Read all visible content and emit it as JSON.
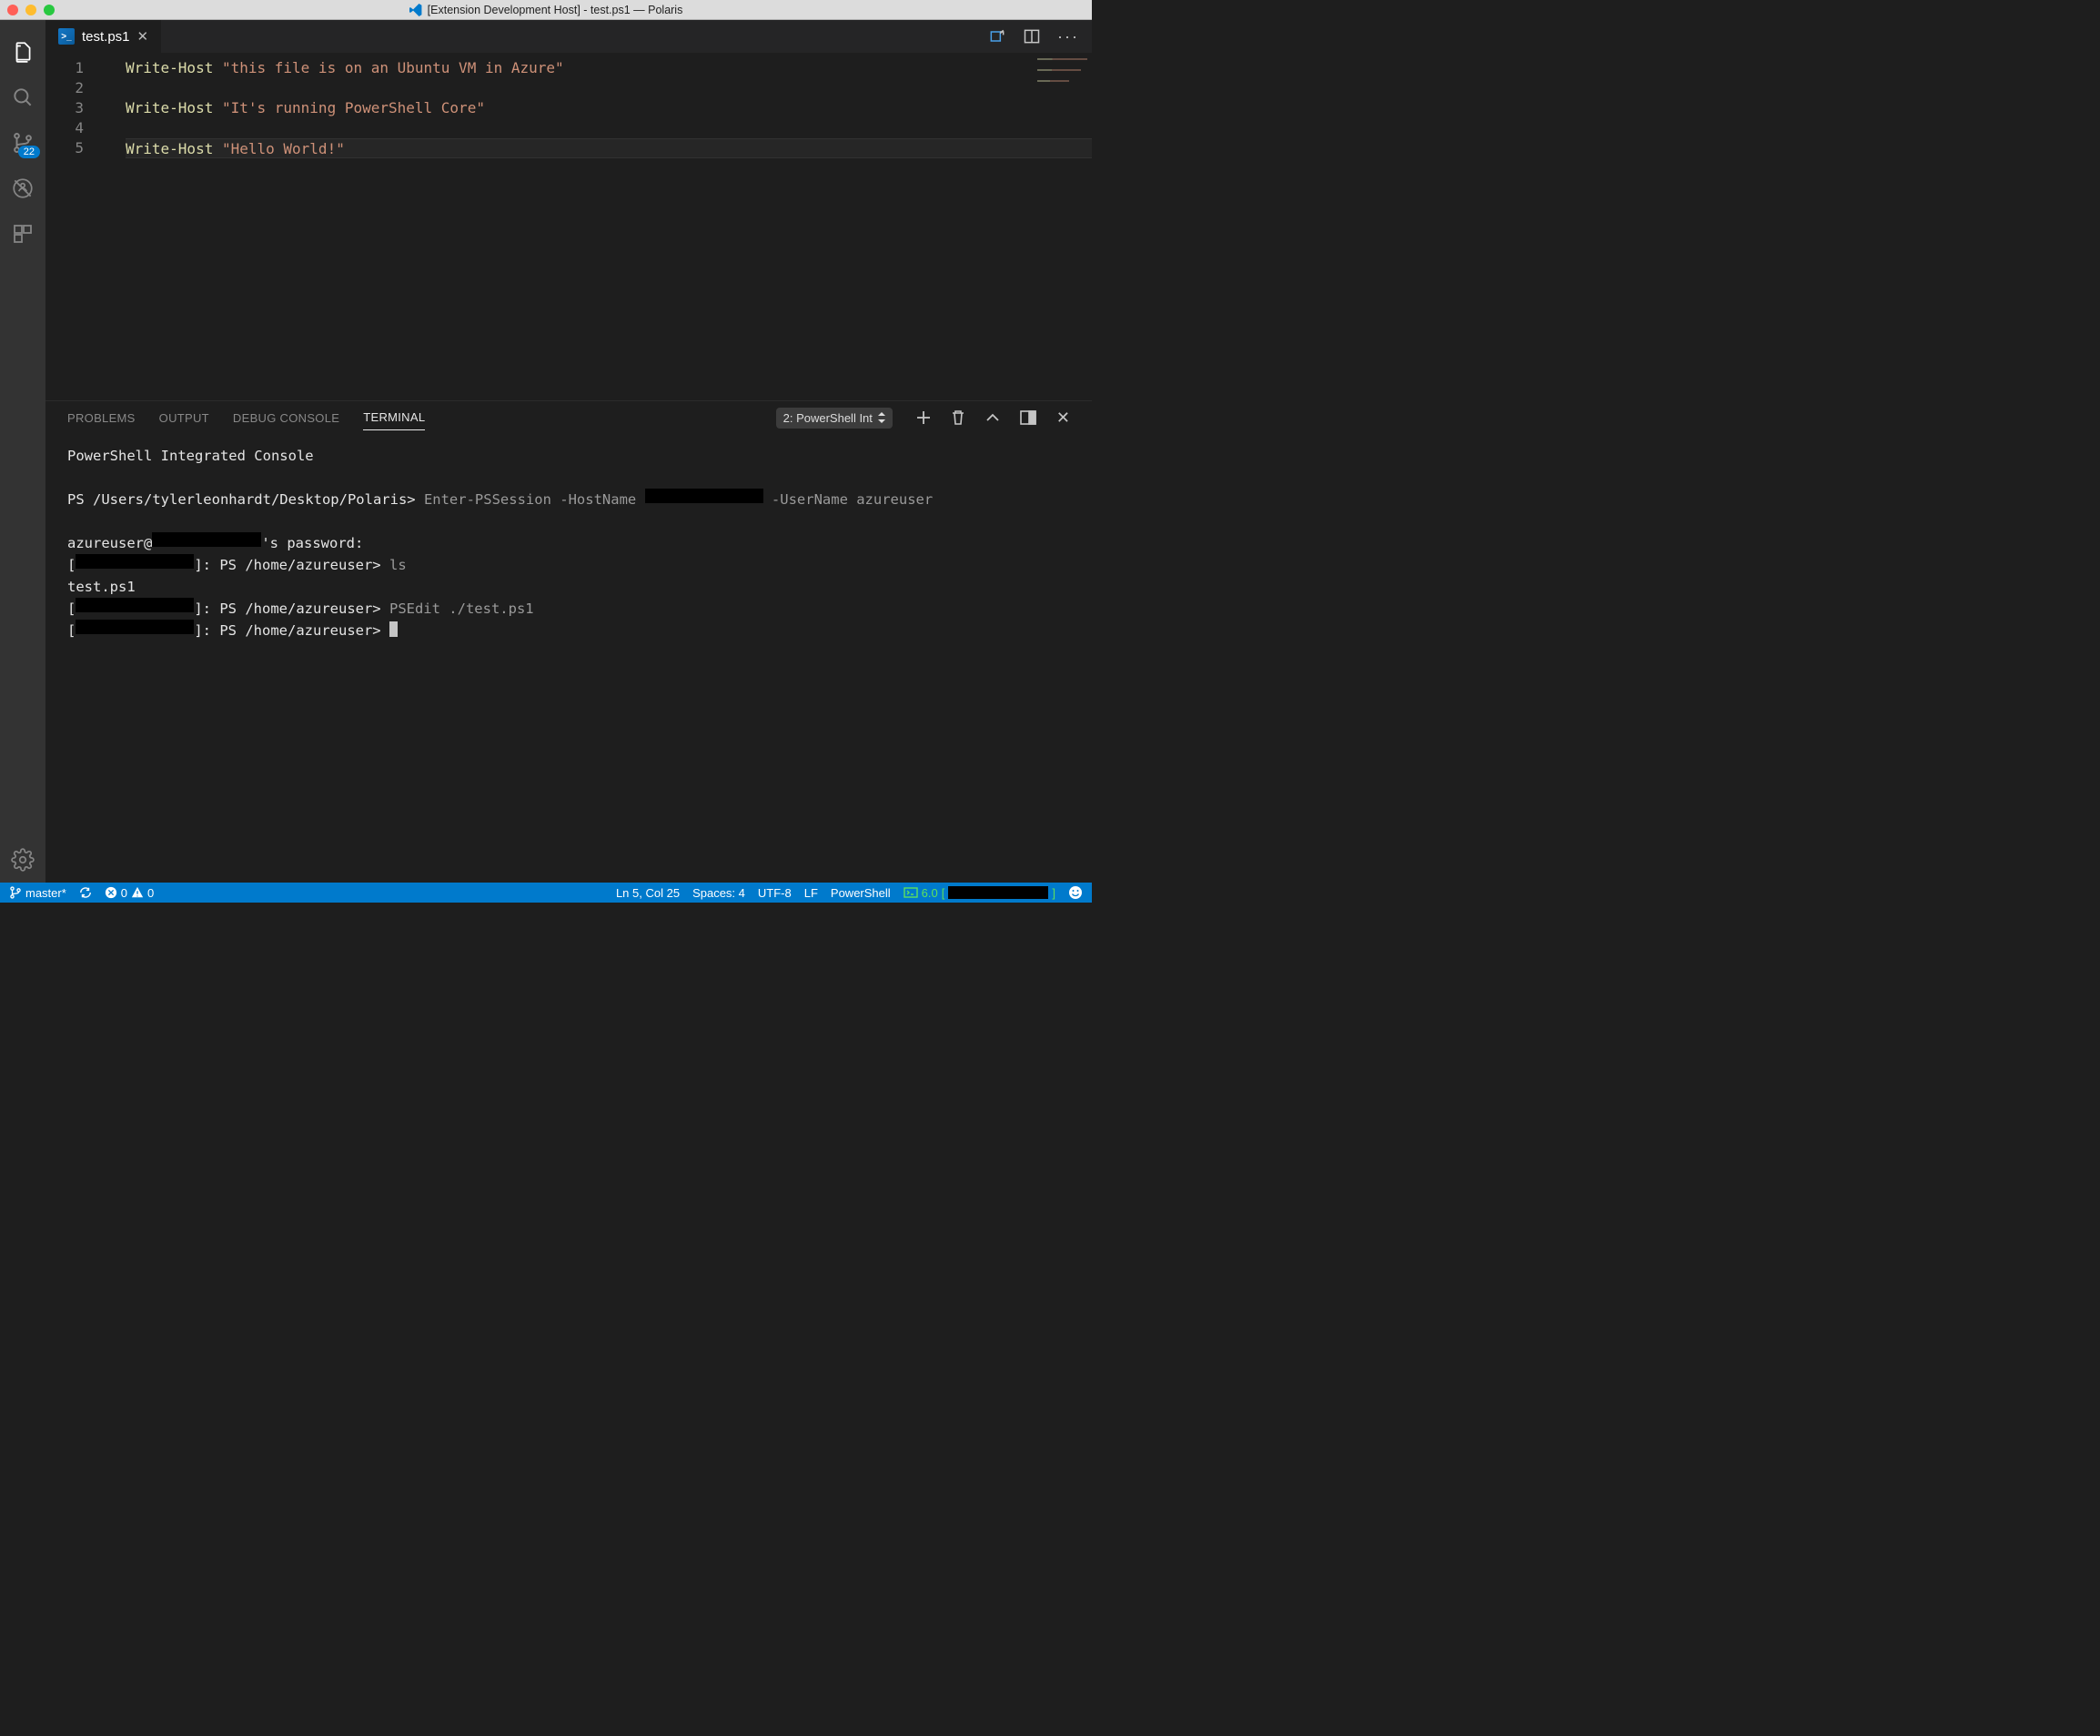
{
  "window": {
    "title": "[Extension Development Host] - test.ps1 — Polaris"
  },
  "activitybar": {
    "scm_badge": "22"
  },
  "tab": {
    "filename": "test.ps1"
  },
  "editor": {
    "line_numbers": [
      "1",
      "2",
      "3",
      "4",
      "5"
    ],
    "lines": {
      "l1_cmd": "Write-Host",
      "l1_str": "\"this file is on an Ubuntu VM in Azure\"",
      "l3_cmd": "Write-Host",
      "l3_str": "\"It's running PowerShell Core\"",
      "l5_cmd": "Write-Host",
      "l5_str": "\"Hello World!\""
    }
  },
  "panel": {
    "tabs": {
      "problems": "PROBLEMS",
      "output": "OUTPUT",
      "debug": "DEBUG CONSOLE",
      "terminal": "TERMINAL"
    },
    "term_select": "2: PowerShell Int"
  },
  "terminal": {
    "header": "PowerShell Integrated Console",
    "line1_prompt": "PS /Users/tylerleonhardt/Desktop/Polaris>",
    "line1_cmd": " Enter-PSSession -HostName ",
    "line1_tail": " -UserName azureuser",
    "line3_a": "azureuser@",
    "line3_b": "'s password:",
    "line4_a": "[",
    "line4_b": "]: PS /home/azureuser> ",
    "line4_cmd": "ls",
    "line5": "test.ps1",
    "line6_a": "[",
    "line6_b": "]: PS /home/azureuser> ",
    "line6_cmd": "PSEdit ./test.ps1",
    "line7_a": "[",
    "line7_b": "]: PS /home/azureuser> "
  },
  "status": {
    "branch": "master*",
    "errors": "0",
    "warnings": "0",
    "cursor": "Ln 5, Col 25",
    "spaces": "Spaces: 4",
    "encoding": "UTF-8",
    "eol": "LF",
    "lang": "PowerShell",
    "ps_version": "6.0"
  }
}
